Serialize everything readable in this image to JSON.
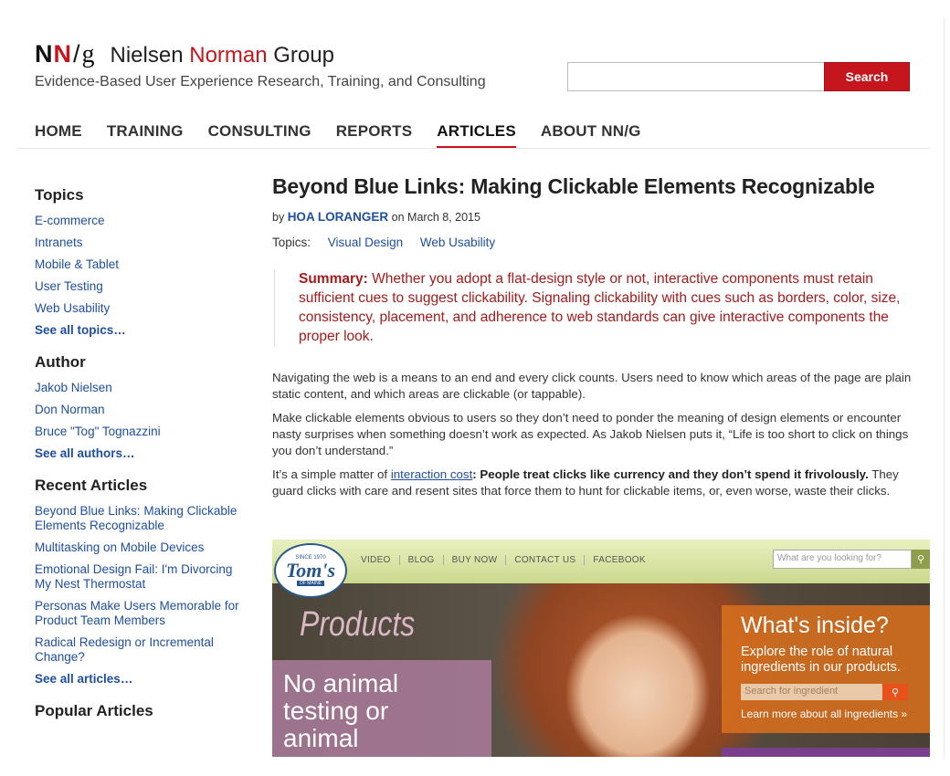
{
  "header": {
    "logo_n1": "N",
    "logo_n2": "N",
    "logo_slash": "/",
    "logo_g": "g",
    "name_part1": "Nielsen ",
    "name_part2": "Norman",
    "name_part3": " Group",
    "tagline": "Evidence-Based User Experience Research, Training, and Consulting",
    "search_value": "",
    "search_button": "Search",
    "accent_color": "#c4161c"
  },
  "nav": {
    "items": [
      "HOME",
      "TRAINING",
      "CONSULTING",
      "REPORTS",
      "ARTICLES",
      "ABOUT NN/G"
    ],
    "active": "ARTICLES"
  },
  "sidebar": {
    "topics": {
      "heading": "Topics",
      "links": [
        "E-commerce",
        "Intranets",
        "Mobile & Tablet",
        "User Testing",
        "Web Usability"
      ],
      "more": "See all topics…"
    },
    "author": {
      "heading": "Author",
      "links": [
        "Jakob Nielsen",
        "Don Norman",
        "Bruce \"Tog\" Tognazzini"
      ],
      "more": "See all authors…"
    },
    "recent": {
      "heading": "Recent Articles",
      "links": [
        "Beyond Blue Links: Making Clickable Elements Recognizable",
        "Multitasking on Mobile Devices",
        "Emotional Design Fail: I'm Divorcing My Nest Thermostat",
        "Personas Make Users Memorable for Product Team Members",
        "Radical Redesign or Incremental Change?"
      ],
      "more": "See all articles…"
    },
    "popular": {
      "heading": "Popular Articles"
    }
  },
  "article": {
    "title": "Beyond Blue Links: Making Clickable Elements Recognizable",
    "by": "by ",
    "author": "HOA LORANGER",
    "date": " on March 8, 2015",
    "topics_label": "Topics:",
    "topics": [
      "Visual Design",
      "Web Usability"
    ],
    "summary_label": "Summary:",
    "summary_text": " Whether you adopt a flat-design style or not, interactive components must retain sufficient cues to suggest clickability. Signaling clickability with cues such as borders, color, size, consistency, placement, and adherence to web standards can give interactive components the proper look.",
    "p1": "Navigating the web is a means to an end and every click counts. Users need to know which areas of the page are plain static content, and which areas are clickable (or tappable).",
    "p2": "Make clickable elements obvious to users so they don’t need to ponder the meaning of design elements or encounter nasty surprises when something doesn’t work as expected. As Jakob Nielsen puts it, “Life is too short to click on things you don’t understand.”",
    "p3_before": "It’s a simple matter of ",
    "p3_link": "interaction cost",
    "p3_bold": ": People treat clicks like currency and they don’t spend it frivolously.",
    "p3_after": " They guard clicks with care and resent sites that force them to hunt for clickable items, or, even worse, waste their clicks."
  },
  "screenshot": {
    "logo_since": "SINCE 1970",
    "logo_name": "Tom's",
    "logo_sub": "OF MAINE",
    "nav": [
      "VIDEO",
      "BLOG",
      "BUY NOW",
      "CONTACT US",
      "FACEBOOK"
    ],
    "search_placeholder": "What are you looking for?",
    "products": "Products",
    "no_animal": "No animal testing or animal",
    "whats_inside": "What's inside?",
    "explore": "Explore the role of natural ingredients in our products.",
    "ingredient_placeholder": "Search for ingredient",
    "learn_more": "Learn more about all ingredients »"
  }
}
